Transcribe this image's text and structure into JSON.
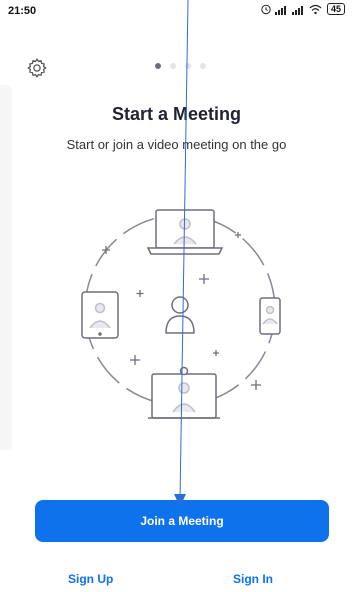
{
  "status_bar": {
    "time": "21:50",
    "battery": "45"
  },
  "pager": {
    "count": 4,
    "active_index": 0
  },
  "heading": {
    "title": "Start a Meeting",
    "subtitle": "Start or join a video meeting on the go"
  },
  "actions": {
    "join_label": "Join a Meeting",
    "sign_up_label": "Sign Up",
    "sign_in_label": "Sign In"
  },
  "colors": {
    "accent": "#0e72ed",
    "annotation_arrow": "#2a6fd6"
  }
}
